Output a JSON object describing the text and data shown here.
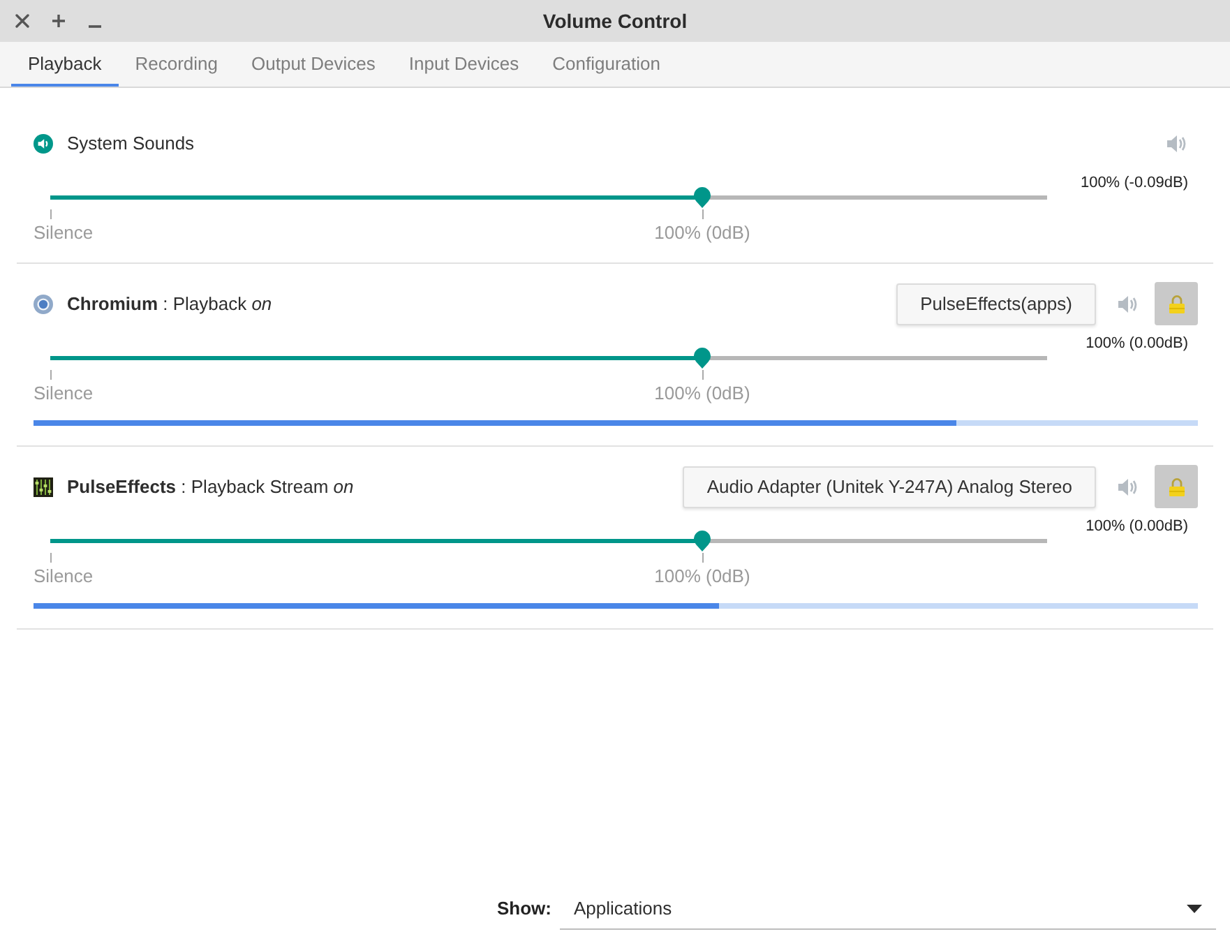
{
  "window": {
    "title": "Volume Control"
  },
  "tabs": [
    {
      "label": "Playback",
      "selected": true
    },
    {
      "label": "Recording",
      "selected": false
    },
    {
      "label": "Output Devices",
      "selected": false
    },
    {
      "label": "Input Devices",
      "selected": false
    },
    {
      "label": "Configuration",
      "selected": false
    }
  ],
  "streams": [
    {
      "kind": "system",
      "label": "System Sounds",
      "muted": false,
      "volume": {
        "level": 0.654,
        "reading": "100% (-0.09dB)",
        "marks": [
          "Silence",
          "100% (0dB)"
        ]
      }
    },
    {
      "kind": "browser",
      "label": "**Chromium** : Playback *on*",
      "device": "PulseEffects(apps)",
      "muted": false,
      "locked": true,
      "volume": {
        "level": 0.654,
        "reading": "100% (0.00dB)",
        "marks": [
          "Silence",
          "100% (0dB)"
        ]
      },
      "meter": {
        "level": 0.793
      }
    },
    {
      "kind": "effects",
      "label": "**PulseEffects** : Playback Stream *on*",
      "device": "Audio Adapter (Unitek Y-247A) Analog Stereo",
      "muted": false,
      "locked": true,
      "volume": {
        "level": 0.654,
        "reading": "100% (0.00dB)",
        "marks": [
          "Silence",
          "100% (0dB)"
        ]
      },
      "meter": {
        "level": 0.589
      }
    }
  ],
  "footer": {
    "label": "Show:",
    "dropdown": {
      "value": "Applications"
    }
  }
}
